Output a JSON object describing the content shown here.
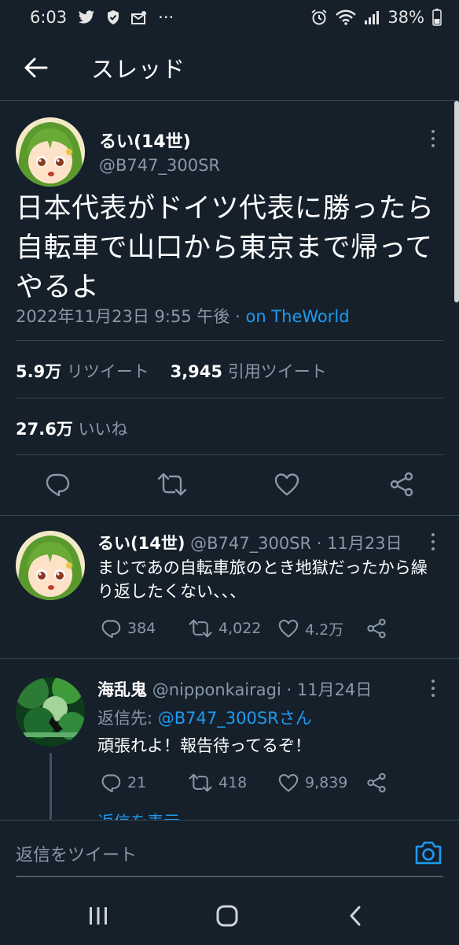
{
  "status_bar": {
    "time": "6:03",
    "ellipsis": "···",
    "battery": "38%",
    "icons": [
      "twitter-icon",
      "shield-check-icon",
      "mail-icon",
      "alarm-icon",
      "wifi-icon",
      "signal-icon",
      "battery-icon"
    ]
  },
  "header": {
    "title": "スレッド",
    "back_icon": "arrow-left-icon"
  },
  "main_tweet": {
    "name": "るい(14世)",
    "handle": "@B747_300SR",
    "text": "日本代表がドイツ代表に勝ったら自転車で山口から東京まで帰ってやるよ",
    "datetime": "2022年11月23日 9:55 午後",
    "separator": "·",
    "source": "on TheWorld",
    "retweets": "5.9万",
    "retweets_label": "リツイート",
    "quotes": "3,945",
    "quotes_label": "引用ツイート",
    "likes": "27.6万",
    "likes_label": "いいね"
  },
  "replies": [
    {
      "name": "るい(14世)",
      "handle": "@B747_300SR",
      "date": "· 11月23日",
      "text": "まじであの自転車旅のとき地獄だったから繰り返したくない、、、",
      "replies": "384",
      "retweets": "4,022",
      "likes": "4.2万"
    },
    {
      "name": "海乱鬼",
      "handle": "@nipponkairagi",
      "date": "· 11月24日",
      "reply_to_label": "返信先:",
      "reply_to": "@B747_300SRさん",
      "text": "頑張れよ！報告待ってるぞ！",
      "replies": "21",
      "retweets": "418",
      "likes": "9,839",
      "show_replies": "返信を表示"
    }
  ],
  "compose": {
    "placeholder": "返信をツイート"
  },
  "colors": {
    "background": "#15202b",
    "divider": "#38444d",
    "muted_text": "#8899a6",
    "link": "#1d9bf0"
  }
}
